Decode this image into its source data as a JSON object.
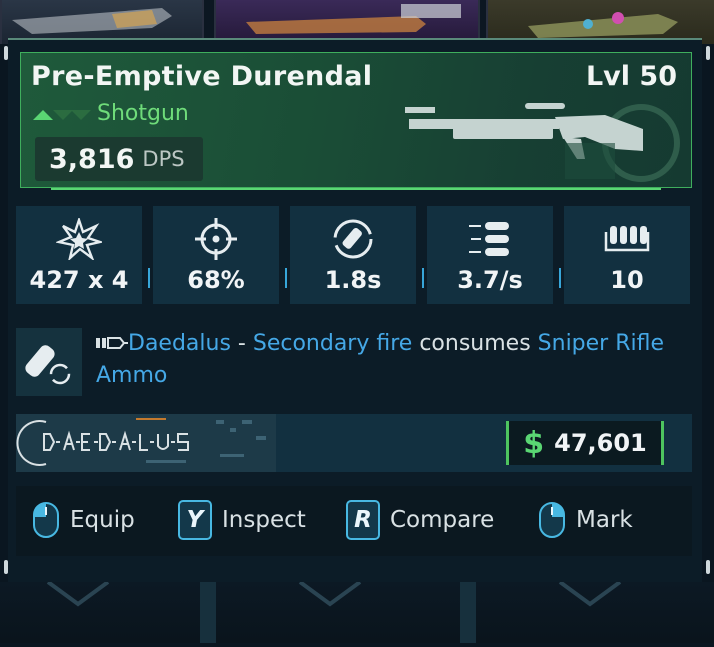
{
  "item": {
    "name": "Pre-Emptive Durendal",
    "level": "Lvl 50",
    "type": "Shotgun",
    "dps_value": "3,816",
    "dps_unit": "DPS"
  },
  "stats": [
    {
      "icon": "damage-burst-icon",
      "value": "427 x 4"
    },
    {
      "icon": "crosshair-accuracy-icon",
      "value": "68%"
    },
    {
      "icon": "reload-icon",
      "value": "1.8s"
    },
    {
      "icon": "fire-rate-icon",
      "value": "3.7/s"
    },
    {
      "icon": "magazine-icon",
      "value": "10"
    }
  ],
  "perk": {
    "name": "Daedalus",
    "separator": " - ",
    "highlight1": "Secondary fire",
    "middle": " consumes ",
    "highlight2": "Sniper Rifle Ammo"
  },
  "manufacturer": {
    "logo_text": "DAEDALUS"
  },
  "price": {
    "symbol": "$",
    "value": "47,601"
  },
  "actions": [
    {
      "key_icon": "mouse-left-icon",
      "label": "Equip"
    },
    {
      "key": "Y",
      "label": "Inspect"
    },
    {
      "key": "R",
      "label": "Compare"
    },
    {
      "key_icon": "mouse-right-icon",
      "label": "Mark"
    }
  ],
  "colors": {
    "rarity_green": "#6fdc7a",
    "highlight_blue": "#45a8e6",
    "keycap_blue": "#48b8e2"
  }
}
